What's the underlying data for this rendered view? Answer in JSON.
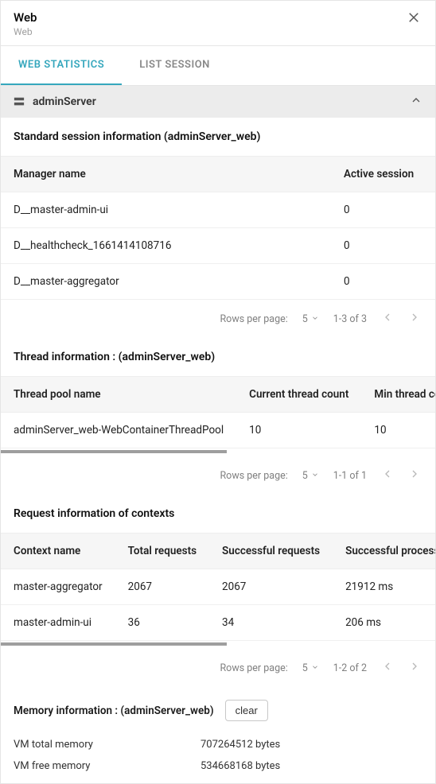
{
  "header": {
    "title": "Web",
    "subtitle": "Web"
  },
  "tabs": {
    "web_stats": "WEB STATISTICS",
    "list_session": "LIST SESSION"
  },
  "accordion": {
    "server": "adminServer"
  },
  "session": {
    "title": "Standard session information (adminServer_web)",
    "col_name": "Manager name",
    "col_active": "Active session",
    "rows": [
      {
        "name": "D__master-admin-ui",
        "active": "0"
      },
      {
        "name": "D__healthcheck_1661414108716",
        "active": "0"
      },
      {
        "name": "D__master-aggregator",
        "active": "0"
      }
    ],
    "pager": {
      "rpp_label": "Rows per page:",
      "rpp": "5",
      "range": "1-3 of 3"
    }
  },
  "thread": {
    "title": "Thread information : (adminServer_web)",
    "col_pool": "Thread pool name",
    "col_cur": "Current thread count",
    "col_min": "Min thread count",
    "rows": [
      {
        "pool": "adminServer_web-WebContainerThreadPool",
        "cur": "10",
        "min": "10"
      }
    ],
    "pager": {
      "rpp_label": "Rows per page:",
      "rpp": "5",
      "range": "1-1 of 1"
    }
  },
  "request": {
    "title": "Request information of contexts",
    "col_ctx": "Context name",
    "col_total": "Total requests",
    "col_succ": "Successful requests",
    "col_time": "Successful processing time",
    "rows": [
      {
        "ctx": "master-aggregator",
        "total": "2067",
        "succ": "2067",
        "time": "21912 ms"
      },
      {
        "ctx": "master-admin-ui",
        "total": "36",
        "succ": "34",
        "time": "206 ms"
      }
    ],
    "pager": {
      "rpp_label": "Rows per page:",
      "rpp": "5",
      "range": "1-2 of 2"
    }
  },
  "memory": {
    "title": "Memory information : (adminServer_web)",
    "clear": "clear",
    "items": [
      {
        "k": "VM total memory",
        "v": "707264512 bytes"
      },
      {
        "k": "VM free memory",
        "v": "534668168 bytes"
      }
    ]
  }
}
